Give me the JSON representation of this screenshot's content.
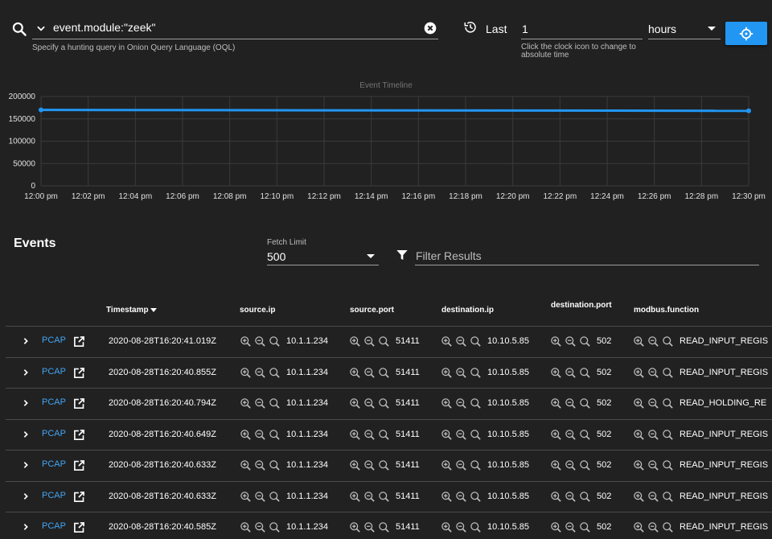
{
  "query": {
    "value": "event.module:\"zeek\"",
    "hint": "Specify a hunting query in Onion Query Language (OQL)"
  },
  "time": {
    "last_label": "Last",
    "amount": "1",
    "amount_hint": "Click the clock icon to change to absolute time",
    "unit": "hours"
  },
  "chart_data": {
    "type": "line",
    "title": "Event Timeline",
    "xlabel": "",
    "ylabel": "",
    "y_ticks": [
      "200000",
      "150000",
      "100000",
      "50000",
      "0"
    ],
    "ylim": [
      0,
      200000
    ],
    "x_ticks": [
      "12:00 pm",
      "12:02 pm",
      "12:04 pm",
      "12:06 pm",
      "12:08 pm",
      "12:10 pm",
      "12:12 pm",
      "12:14 pm",
      "12:16 pm",
      "12:18 pm",
      "12:20 pm",
      "12:22 pm",
      "12:24 pm",
      "12:26 pm",
      "12:28 pm",
      "12:30 pm"
    ],
    "series": [
      {
        "x": [
          "12:00 pm",
          "12:30 pm"
        ],
        "values": [
          170000,
          168000
        ]
      }
    ],
    "grid": true,
    "line_color": "#2196f3"
  },
  "events": {
    "title": "Events",
    "fetch_label": "Fetch Limit",
    "fetch_value": "500",
    "filter_placeholder": "Filter Results"
  },
  "table": {
    "columns": [
      "Timestamp",
      "source.ip",
      "source.port",
      "destination.ip",
      "destination.port",
      "modbus.function"
    ],
    "pcap_label": "PCAP",
    "rows": [
      [
        "2020-08-28T16:20:41.019Z",
        "10.1.1.234",
        "51411",
        "10.10.5.85",
        "502",
        "READ_INPUT_REGIS"
      ],
      [
        "2020-08-28T16:20:40.855Z",
        "10.1.1.234",
        "51411",
        "10.10.5.85",
        "502",
        "READ_INPUT_REGIS"
      ],
      [
        "2020-08-28T16:20:40.794Z",
        "10.1.1.234",
        "51411",
        "10.10.5.85",
        "502",
        "READ_HOLDING_RE"
      ],
      [
        "2020-08-28T16:20:40.649Z",
        "10.1.1.234",
        "51411",
        "10.10.5.85",
        "502",
        "READ_INPUT_REGIS"
      ],
      [
        "2020-08-28T16:20:40.633Z",
        "10.1.1.234",
        "51411",
        "10.10.5.85",
        "502",
        "READ_INPUT_REGIS"
      ],
      [
        "2020-08-28T16:20:40.633Z",
        "10.1.1.234",
        "51411",
        "10.10.5.85",
        "502",
        "READ_INPUT_REGIS"
      ],
      [
        "2020-08-28T16:20:40.585Z",
        "10.1.1.234",
        "51411",
        "10.10.5.85",
        "502",
        "READ_INPUT_REGIS"
      ]
    ]
  }
}
